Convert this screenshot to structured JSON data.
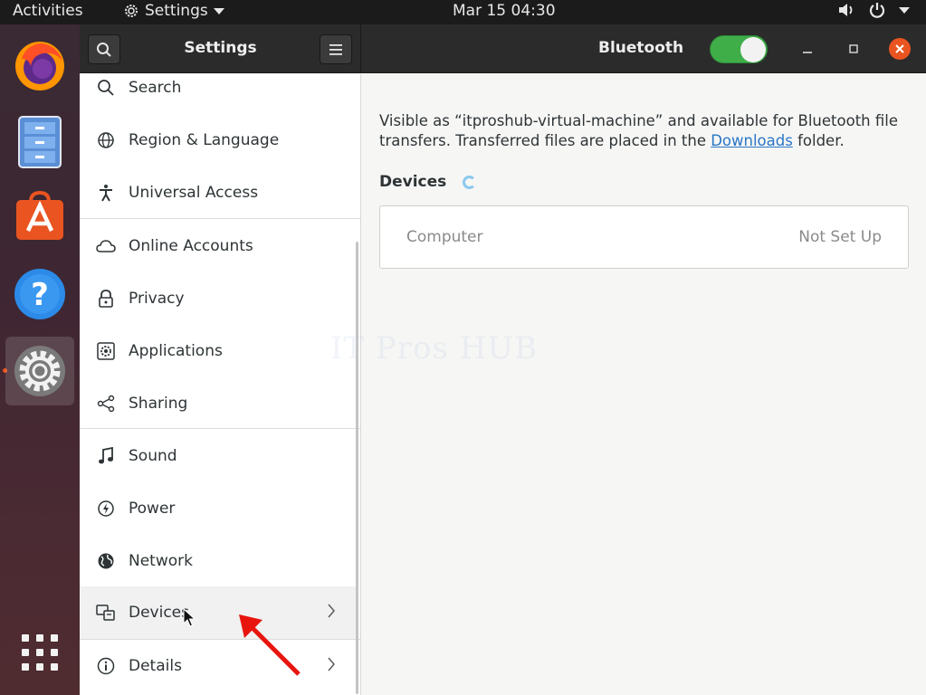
{
  "topbar": {
    "activities": "Activities",
    "app_name": "Settings",
    "clock": "Mar 15  04:30"
  },
  "dock": {
    "items": [
      {
        "name": "firefox"
      },
      {
        "name": "files"
      },
      {
        "name": "software"
      },
      {
        "name": "help"
      },
      {
        "name": "settings",
        "active": true
      },
      {
        "name": "show-applications"
      }
    ]
  },
  "window": {
    "sidebar_title": "Settings",
    "panel_title": "Bluetooth",
    "bluetooth_enabled": true
  },
  "sidebar": {
    "items": [
      {
        "label": "Search",
        "icon": "search-icon"
      },
      {
        "label": "Region & Language",
        "icon": "globe-icon"
      },
      {
        "label": "Universal Access",
        "icon": "accessibility-icon"
      },
      {
        "label": "Online Accounts",
        "icon": "cloud-icon"
      },
      {
        "label": "Privacy",
        "icon": "lock-icon"
      },
      {
        "label": "Applications",
        "icon": "applications-icon"
      },
      {
        "label": "Sharing",
        "icon": "share-icon"
      },
      {
        "label": "Sound",
        "icon": "music-note-icon"
      },
      {
        "label": "Power",
        "icon": "power-icon"
      },
      {
        "label": "Network",
        "icon": "network-globe-icon"
      },
      {
        "label": "Devices",
        "icon": "devices-icon",
        "chevron": true
      },
      {
        "label": "Details",
        "icon": "info-icon",
        "chevron": true
      }
    ]
  },
  "content": {
    "desc_before": "Visible as “itproshub-virtual-machine” and available for Bluetooth file transfers. Transferred files are placed in the ",
    "desc_link": "Downloads",
    "desc_after": " folder.",
    "devices_header": "Devices",
    "devices": [
      {
        "name": "Computer",
        "status": "Not Set Up"
      }
    ],
    "watermark": "IT Pros HUB"
  },
  "colors": {
    "accent_orange": "#e95420",
    "switch_green": "#3fae49",
    "link_blue": "#2a76c6"
  }
}
